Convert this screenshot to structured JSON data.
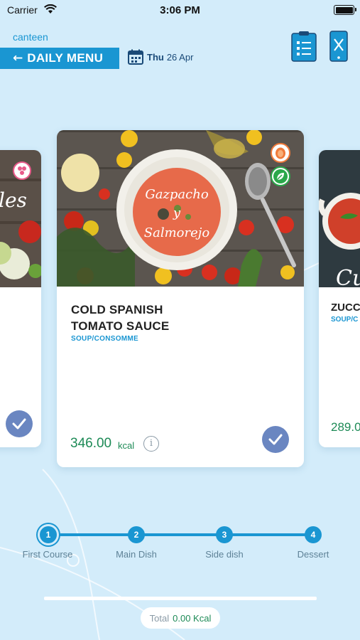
{
  "status_bar": {
    "carrier": "Carrier",
    "time": "3:06 PM"
  },
  "header": {
    "app_name": "canteen",
    "back_label": "DAILY MENU",
    "date_day": "Thu",
    "date_num": "26 Apr"
  },
  "cards": {
    "main": {
      "image_caption_1": "Gazpacho",
      "image_caption_2": "y",
      "image_caption_3": "Salmorejo",
      "name_line1": "COLD SPANISH",
      "name_line2": "TOMATO SAUCE",
      "category": "SOUP/CONSOMME",
      "kcal": "346.00",
      "kcal_unit": "kcal",
      "info": "i"
    },
    "left": {
      "image_caption": "les"
    },
    "right": {
      "image_caption": "Cu",
      "name": "ZUCCH",
      "category": "SOUP/C",
      "kcal": "289.0"
    }
  },
  "steps": [
    {
      "number": "1",
      "label": "First Course"
    },
    {
      "number": "2",
      "label": "Main Dish"
    },
    {
      "number": "3",
      "label": "Side dish"
    },
    {
      "number": "4",
      "label": "Dessert"
    }
  ],
  "total": {
    "label": "Total",
    "value": "0.00 Kcal"
  },
  "colors": {
    "accent": "#1a96d2",
    "background": "#d3ecfa",
    "kcal": "#1d8a56",
    "check": "#6a86c1",
    "navy": "#1a4a78"
  }
}
